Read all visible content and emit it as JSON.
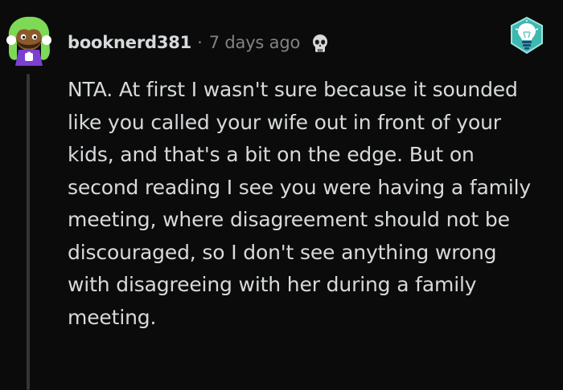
{
  "comment": {
    "author": "booknerd381",
    "separator": "·",
    "time": "7 days ago",
    "body": "NTA. At first I wasn't sure because it sounded like you called your wife out in front of your kids, and that's a bit on the edge. But on second reading I see you were having a family meeting, where disagreement should not be discouraged, so I don't see anything wrong with disagreeing with her during a family meeting."
  },
  "icons": {
    "avatar": "snoo-avatar-icon",
    "flair": "skull-icon",
    "award": "lightbulb-award-icon"
  },
  "colors": {
    "background": "#0b0b0b",
    "text": "#d7dadc",
    "meta": "#818384",
    "thread_line": "#343536",
    "avatar_hair": "#7ed957",
    "avatar_shirt": "#7b3fd1",
    "award_teal": "#3fb8b0"
  }
}
